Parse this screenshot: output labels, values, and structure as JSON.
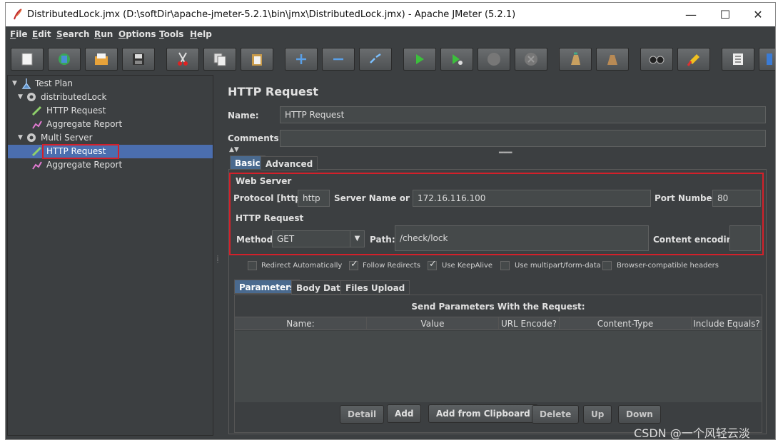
{
  "window": {
    "title": "DistributedLock.jmx (D:\\softDir\\apache-jmeter-5.2.1\\bin\\jmx\\DistributedLock.jmx) - Apache JMeter (5.2.1)"
  },
  "menu": [
    "File",
    "Edit",
    "Search",
    "Run",
    "Options",
    "Tools",
    "Help"
  ],
  "toolbar": {
    "icons": [
      "new-icon",
      "templates-icon",
      "open-icon",
      "save-icon",
      "cut-icon",
      "copy-icon",
      "paste-icon",
      "expand-icon",
      "collapse-icon",
      "toggle-icon",
      "start-icon",
      "start-no-pauses-icon",
      "stop-icon",
      "shutdown-icon",
      "clear-icon",
      "clear-all-icon",
      "search-icon",
      "reset-search-icon",
      "function-helper-icon",
      "help-icon"
    ]
  },
  "tree": {
    "test_plan": "Test Plan",
    "group1": "distributedLock",
    "group1_items": [
      "HTTP Request",
      "Aggregate Report"
    ],
    "group2": "Multi Server",
    "group2_items": [
      "HTTP Request",
      "Aggregate Report"
    ]
  },
  "panel": {
    "title": "HTTP Request",
    "name_label": "Name:",
    "name_value": "HTTP Request",
    "comments_label": "Comments:",
    "comments_value": "",
    "tabs": [
      "Basic",
      "Advanced"
    ]
  },
  "web_server": {
    "legend": "Web Server",
    "protocol_label": "Protocol [http]:",
    "protocol_value": "http",
    "server_label": "Server Name or IP:",
    "server_value": "172.16.116.100",
    "port_label": "Port Number:",
    "port_value": "80"
  },
  "http_request": {
    "legend": "HTTP Request",
    "method_label": "Method:",
    "method_value": "GET",
    "path_label": "Path:",
    "path_value": "/check/lock",
    "encoding_label": "Content encoding:",
    "encoding_value": ""
  },
  "options": [
    {
      "label": "Redirect Automatically",
      "checked": false
    },
    {
      "label": "Follow Redirects",
      "checked": true
    },
    {
      "label": "Use KeepAlive",
      "checked": true
    },
    {
      "label": "Use multipart/form-data",
      "checked": false
    },
    {
      "label": "Browser-compatible headers",
      "checked": false
    }
  ],
  "param_tabs": [
    "Parameters",
    "Body Data",
    "Files Upload"
  ],
  "params": {
    "heading": "Send Parameters With the Request:",
    "columns": [
      "Name:",
      "Value",
      "URL Encode?",
      "Content-Type",
      "Include Equals?"
    ]
  },
  "buttons": [
    "Detail",
    "Add",
    "Add from Clipboard",
    "Delete",
    "Up",
    "Down"
  ],
  "watermark": "CSDN @一个风轻云淡"
}
